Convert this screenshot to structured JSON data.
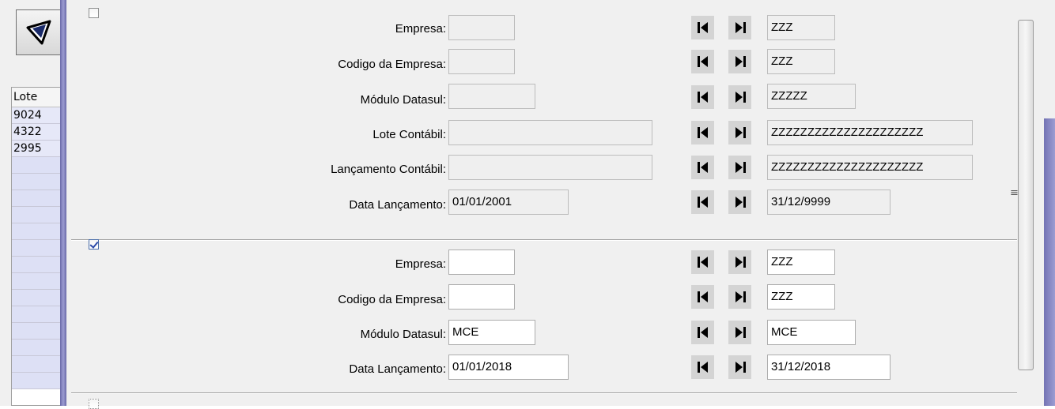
{
  "left_panel": {
    "column_header": "Lote",
    "rows": [
      "9024",
      "4322",
      "2995",
      "",
      "",
      "",
      "",
      "",
      "",
      "",
      "",
      "",
      "",
      "",
      "",
      "",
      ""
    ]
  },
  "section1": {
    "checked": false,
    "fields": [
      {
        "label": "Empresa:",
        "from": "",
        "to": "ZZZ"
      },
      {
        "label": "Codigo da Empresa:",
        "from": "",
        "to": "ZZZ"
      },
      {
        "label": "Módulo Datasul:",
        "from": "",
        "to": "ZZZZZ"
      },
      {
        "label": "Lote Contábil:",
        "from": "",
        "to": "ZZZZZZZZZZZZZZZZZZZZZ"
      },
      {
        "label": "Lançamento Contábil:",
        "from": "",
        "to": "ZZZZZZZZZZZZZZZZZZZZZ"
      },
      {
        "label": "Data Lançamento:",
        "from": "01/01/2001",
        "to": "31/12/9999"
      }
    ]
  },
  "section2": {
    "checked": true,
    "fields": [
      {
        "label": "Empresa:",
        "from": "",
        "to": "ZZZ"
      },
      {
        "label": "Codigo da Empresa:",
        "from": "",
        "to": "ZZZ"
      },
      {
        "label": "Módulo Datasul:",
        "from": "MCE",
        "to": "MCE"
      },
      {
        "label": "Data Lançamento:",
        "from": "01/01/2018",
        "to": "31/12/2018"
      }
    ]
  },
  "icons": {
    "filter": "filter-funnel-icon",
    "first": "first-record-icon",
    "last": "last-record-icon",
    "scroll_grip": "scroll-grip-icon"
  },
  "colors": {
    "accent_purple": "#8c8cc8",
    "grid_row": "#dde0f5",
    "nav_button": "#d4d4d4"
  }
}
